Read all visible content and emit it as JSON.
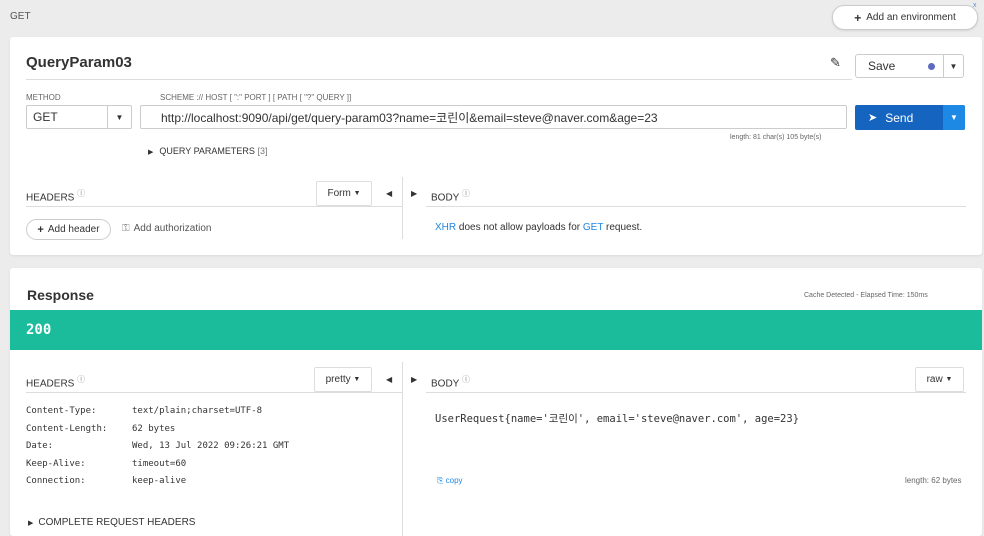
{
  "topbar": {
    "breadcrumb": "GET",
    "env_button": "Add an environment",
    "corner_mark": "x"
  },
  "request": {
    "title": "QueryParam03",
    "save_label": "Save",
    "method_label": "METHOD",
    "url_label": "SCHEME :// HOST [ \":\" PORT ] [ PATH [ \"?\" QUERY ]]",
    "method": "GET",
    "url": "http://localhost:9090/api/get/query-param03?name=코린이&email=steve@naver.com&age=23",
    "send_label": "Send",
    "length_info": "length: 81 char(s) 105 byte(s)",
    "query_params_label": "QUERY PARAMETERS",
    "query_params_count": "[3]",
    "headers_label": "HEADERS",
    "headers_mode": "Form",
    "body_label": "BODY",
    "add_header_label": "Add header",
    "add_auth_label": "Add authorization",
    "xhr_msg": {
      "xhr": "XHR",
      "mid": " does not allow payloads for ",
      "method": "GET",
      "end": " request."
    }
  },
  "response": {
    "title": "Response",
    "cache_info": "Cache Detected - Elapsed Time: 150ms",
    "status_code": "200",
    "headers_label": "HEADERS",
    "headers_mode": "pretty",
    "body_label": "BODY",
    "body_mode": "raw",
    "headers": [
      {
        "key": "Content-Type:",
        "value": "text/plain;charset=UTF-8"
      },
      {
        "key": "Content-Length:",
        "value": "62 bytes"
      },
      {
        "key": "Date:",
        "value": "Wed, 13 Jul 2022 09:26:21 GMT"
      },
      {
        "key": "Keep-Alive:",
        "value": "timeout=60"
      },
      {
        "key": "Connection:",
        "value": "keep-alive"
      }
    ],
    "body": "UserRequest{name='코린이', email='steve@naver.com', age=23}",
    "copy_label": "copy",
    "length": "length: 62 bytes",
    "complete_headers_label": "COMPLETE REQUEST HEADERS"
  },
  "colors": {
    "status_bar": "#1bbc9b",
    "send_button": "#1565c0",
    "accent_blue": "#1e88e5"
  }
}
